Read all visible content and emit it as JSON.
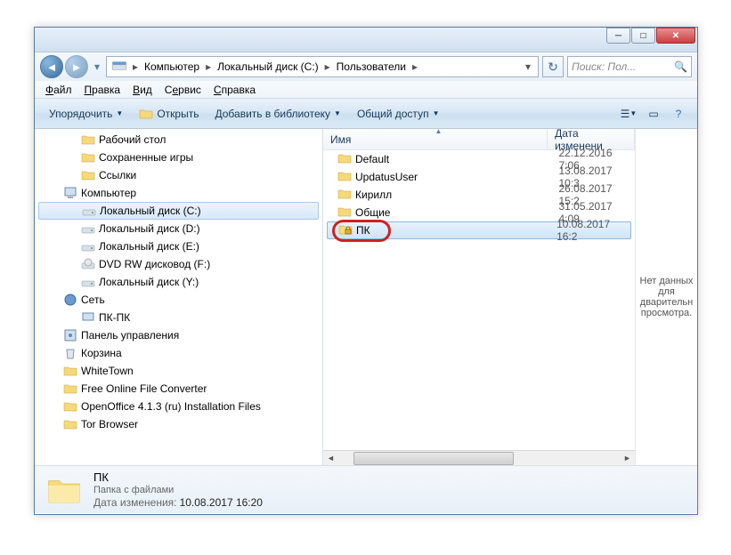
{
  "breadcrumb": [
    "Компьютер",
    "Локальный диск (C:)",
    "Пользователи"
  ],
  "search_placeholder": "Поиск: Пол...",
  "menu": {
    "file": "Файл",
    "edit": "Правка",
    "view": "Вид",
    "tools": "Сервис",
    "help": "Справка"
  },
  "toolbar": {
    "organize": "Упорядочить",
    "open": "Открыть",
    "library": "Добавить в библиотеку",
    "share": "Общий доступ"
  },
  "tree": [
    {
      "label": "Рабочий стол",
      "level": 2,
      "icon": "folder"
    },
    {
      "label": "Сохраненные игры",
      "level": 2,
      "icon": "folder"
    },
    {
      "label": "Ссылки",
      "level": 2,
      "icon": "folder"
    },
    {
      "label": "Компьютер",
      "level": 1,
      "icon": "computer"
    },
    {
      "label": "Локальный диск (C:)",
      "level": 2,
      "icon": "drive",
      "selected": true
    },
    {
      "label": "Локальный диск (D:)",
      "level": 2,
      "icon": "drive"
    },
    {
      "label": "Локальный диск (E:)",
      "level": 2,
      "icon": "drive"
    },
    {
      "label": "DVD RW дисковод (F:)",
      "level": 2,
      "icon": "dvd"
    },
    {
      "label": "Локальный диск (Y:)",
      "level": 2,
      "icon": "drive"
    },
    {
      "label": "Сеть",
      "level": 1,
      "icon": "network"
    },
    {
      "label": "ПК-ПК",
      "level": 2,
      "icon": "pc"
    },
    {
      "label": "Панель управления",
      "level": 1,
      "icon": "cpanel"
    },
    {
      "label": "Корзина",
      "level": 1,
      "icon": "trash"
    },
    {
      "label": "WhiteTown",
      "level": 1,
      "icon": "folder"
    },
    {
      "label": "Free Online File Converter",
      "level": 1,
      "icon": "folder"
    },
    {
      "label": "OpenOffice 4.1.3 (ru) Installation Files",
      "level": 1,
      "icon": "folder"
    },
    {
      "label": "Tor Browser",
      "level": 1,
      "icon": "folder"
    }
  ],
  "columns": {
    "name": "Имя",
    "date": "Дата изменени"
  },
  "files": [
    {
      "name": "Default",
      "date": "22.12.2016 7:06",
      "icon": "folder"
    },
    {
      "name": "UpdatusUser",
      "date": "13.08.2017 10:3",
      "icon": "folder"
    },
    {
      "name": "Кирилл",
      "date": "26.08.2017 15:2",
      "icon": "folder"
    },
    {
      "name": "Общие",
      "date": "31.05.2017 4:09",
      "icon": "folder"
    },
    {
      "name": "ПК",
      "date": "10.08.2017 16:2",
      "icon": "folder-lock",
      "selected": true
    }
  ],
  "preview_text": "Нет данных для дварительн просмотра.",
  "details": {
    "title": "ПК",
    "subtitle": "Папка с файлами",
    "date_label": "Дата изменения:",
    "date_value": "10.08.2017 16:20"
  }
}
